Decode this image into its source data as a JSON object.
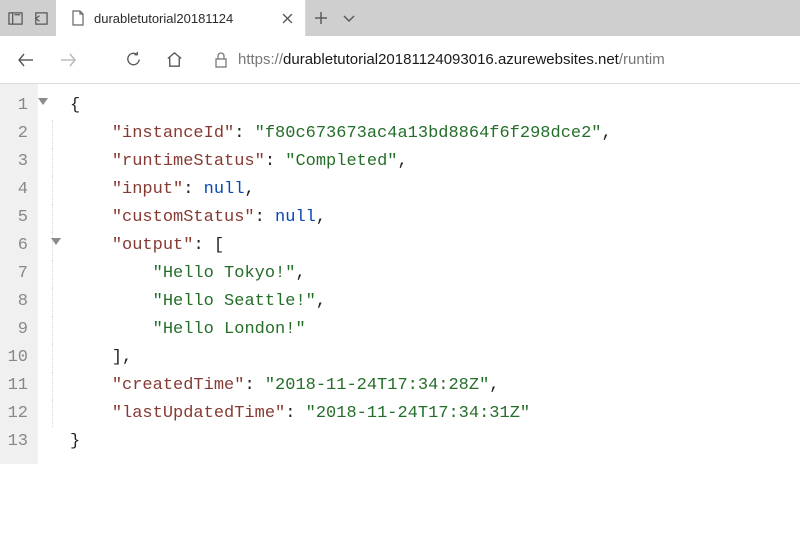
{
  "tab": {
    "title": "durabletutorial20181124"
  },
  "url": {
    "scheme": "https://",
    "host": "durabletutorial20181124093016.azurewebsites.net",
    "path": "/runtim"
  },
  "json_keys": {
    "instanceId": "\"instanceId\"",
    "runtimeStatus": "\"runtimeStatus\"",
    "input": "\"input\"",
    "customStatus": "\"customStatus\"",
    "output": "\"output\"",
    "createdTime": "\"createdTime\"",
    "lastUpdatedTime": "\"lastUpdatedTime\""
  },
  "json_vals": {
    "instanceId": "\"f80c673673ac4a13bd8864f6f298dce2\"",
    "runtimeStatus": "\"Completed\"",
    "null": "null",
    "out0": "\"Hello Tokyo!\"",
    "out1": "\"Hello Seattle!\"",
    "out2": "\"Hello London!\"",
    "createdTime": "\"2018-11-24T17:34:28Z\"",
    "lastUpdatedTime": "\"2018-11-24T17:34:31Z\""
  },
  "gutter": [
    "1",
    "2",
    "3",
    "4",
    "5",
    "6",
    "7",
    "8",
    "9",
    "10",
    "11",
    "12",
    "13"
  ],
  "punct": {
    "obrace": "{",
    "cbrace": "}",
    "obracket": "[",
    "cbracket": "]",
    "colon_sp": ": ",
    "comma": ","
  }
}
